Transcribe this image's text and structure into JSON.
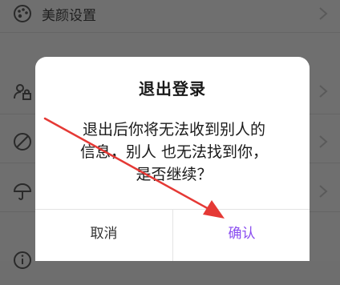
{
  "settings": {
    "rows": [
      {
        "label": "美颜设置",
        "icon": "palette-icon"
      },
      {
        "label": "",
        "icon": "user-lock-icon"
      },
      {
        "label": "",
        "icon": "block-icon"
      },
      {
        "label": "",
        "icon": "umbrella-icon"
      },
      {
        "label": "",
        "icon": "info-icon"
      }
    ]
  },
  "dialog": {
    "title": "退出登录",
    "message_lines": [
      "退出后你将无法收到别人的",
      "信息，别人 也无法找到你，",
      "是否继续？"
    ],
    "cancel_label": "取消",
    "confirm_label": "确认"
  },
  "colors": {
    "confirm": "#8a4df0",
    "arrow": "#e53935",
    "overlay_bg": "#6f6f6f"
  }
}
